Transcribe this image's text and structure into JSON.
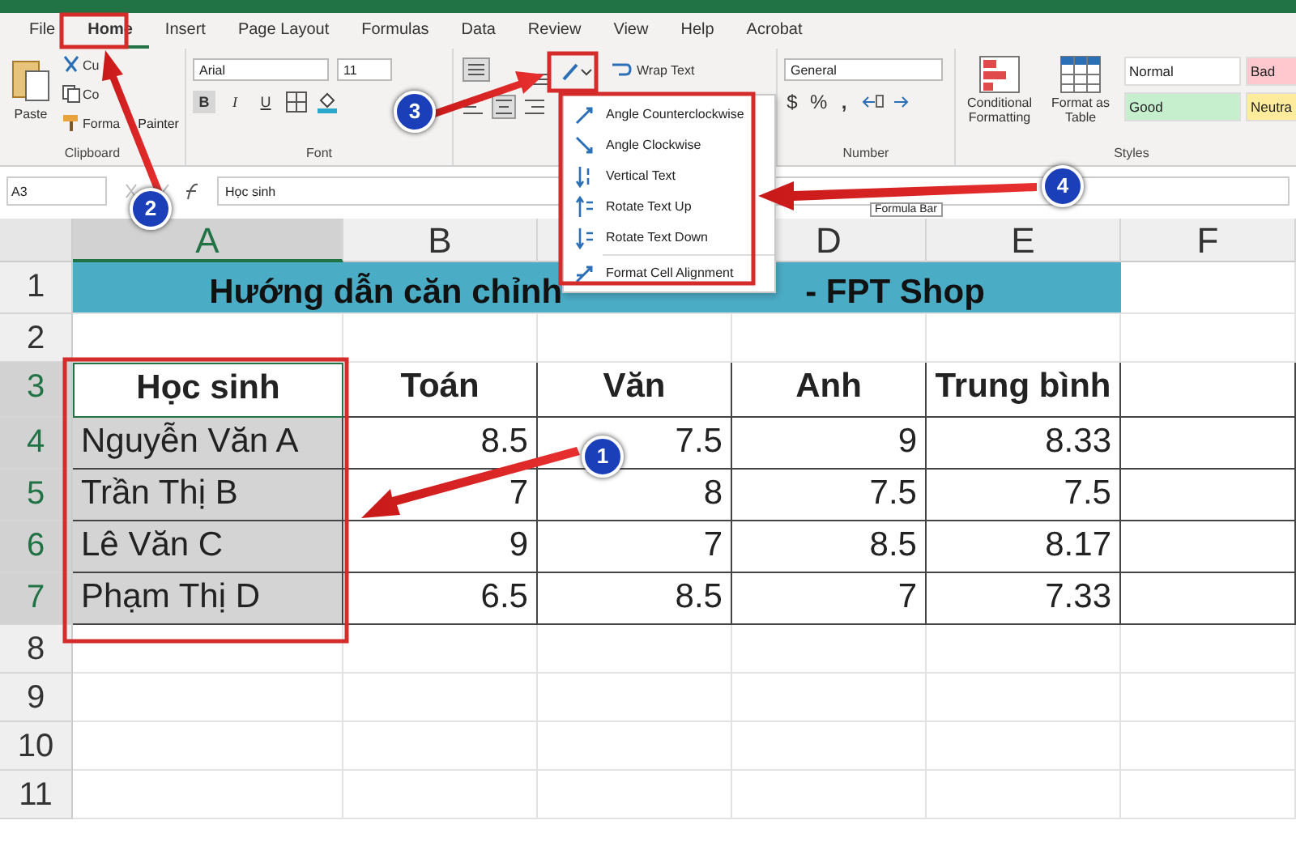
{
  "tabs": [
    {
      "label": "File",
      "selected": false
    },
    {
      "label": "Home",
      "selected": true
    },
    {
      "label": "Insert",
      "selected": false
    },
    {
      "label": "Page Layout",
      "selected": false
    },
    {
      "label": "Formulas",
      "selected": false
    },
    {
      "label": "Data",
      "selected": false
    },
    {
      "label": "Review",
      "selected": false
    },
    {
      "label": "View",
      "selected": false
    },
    {
      "label": "Help",
      "selected": false
    },
    {
      "label": "Acrobat",
      "selected": false
    }
  ],
  "ribbon": {
    "clipboard": {
      "paste": "Paste",
      "cut": "Cu",
      "copy": "Co",
      "format_painter": [
        "Forma",
        "Painter"
      ],
      "label": "Clipboard"
    },
    "font": {
      "name": "Arial",
      "size": "11",
      "bold": "B",
      "italic": "I",
      "underline": "U",
      "label": "Font"
    },
    "alignment": {
      "wrap_text": "Wrap Text"
    },
    "number": {
      "format": "General",
      "currency": "$",
      "percent": "%",
      "comma": ",",
      "label": "Number"
    },
    "styles": {
      "conditional": "Conditional Formatting",
      "table": "Format as Table",
      "label": "Styles",
      "cells": [
        {
          "label": "Normal",
          "color": "#ffffff"
        },
        {
          "label": "Bad",
          "color": "#ffc7ce"
        },
        {
          "label": "Good",
          "color": "#c6efce"
        },
        {
          "label": "Neutra",
          "color": "#ffeb9c"
        }
      ]
    }
  },
  "orientation_menu": {
    "items": [
      {
        "label": "Angle Counterclockwise",
        "kind": "ccw"
      },
      {
        "label": "Angle Clockwise",
        "kind": "cw"
      },
      {
        "label": "Vertical Text",
        "kind": "vertical"
      },
      {
        "label": "Rotate Text Up",
        "kind": "up"
      },
      {
        "label": "Rotate Text Down",
        "kind": "down"
      },
      {
        "label": "Format Cell Alignment",
        "kind": "format"
      }
    ]
  },
  "formula_bar": {
    "name_box": "A3",
    "value": "Học sinh",
    "tooltip": "Formula Bar"
  },
  "sheet": {
    "columns": [
      {
        "label": "A",
        "selected": true
      },
      {
        "label": "B",
        "selected": false
      },
      {
        "selected": false
      },
      {
        "label": "D",
        "selected": false
      },
      {
        "label": "E",
        "selected": false
      },
      {
        "label": "F",
        "selected": false
      }
    ],
    "rows": [
      {
        "number": "1",
        "kind": "title",
        "selected": false,
        "title_parts": [
          "Hướng dẫn căn chỉnh",
          "- FPT Shop"
        ]
      },
      {
        "number": "2",
        "kind": "empty",
        "selected": false,
        "cells": []
      },
      {
        "number": "3",
        "kind": "header",
        "selected": true,
        "cells": [
          "Học sinh",
          "Toán",
          "Văn",
          "Anh",
          "Trung bình"
        ]
      },
      {
        "number": "4",
        "kind": "data",
        "selected": true,
        "cells": [
          "Nguyễn Văn A",
          "8.5",
          "7.5",
          "9",
          "8.33"
        ]
      },
      {
        "number": "5",
        "kind": "data",
        "selected": true,
        "cells": [
          "Trần Thị B",
          "7",
          "8",
          "7.5",
          "7.5"
        ]
      },
      {
        "number": "6",
        "kind": "data",
        "selected": true,
        "cells": [
          "Lê Văn C",
          "9",
          "7",
          "8.5",
          "8.17"
        ]
      },
      {
        "number": "7",
        "kind": "data",
        "selected": true,
        "cells": [
          "Phạm Thị D",
          "6.5",
          "8.5",
          "7",
          "7.33"
        ]
      },
      {
        "number": "8",
        "kind": "empty",
        "selected": false,
        "cells": []
      },
      {
        "number": "9",
        "kind": "empty",
        "selected": false,
        "cells": []
      },
      {
        "number": "10",
        "kind": "empty",
        "selected": false,
        "cells": []
      },
      {
        "number": "11",
        "kind": "empty",
        "selected": false,
        "cells": []
      }
    ]
  },
  "annotations": [
    {
      "label": "1",
      "kind": "sheet"
    },
    {
      "label": "2",
      "kind": "home"
    },
    {
      "label": "3",
      "kind": "orientation"
    },
    {
      "label": "4",
      "kind": "menu"
    }
  ]
}
